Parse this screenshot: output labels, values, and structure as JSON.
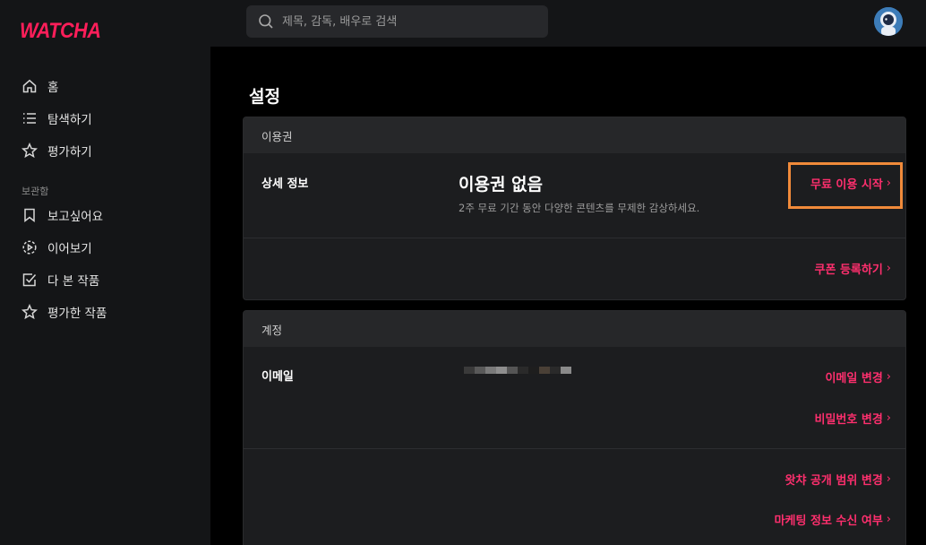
{
  "app": {
    "logo": "WATCHA",
    "brand_color": "#ff1e5a"
  },
  "sidebar": {
    "items": [
      {
        "label": "홈",
        "icon": "home-icon"
      },
      {
        "label": "탐색하기",
        "icon": "list-icon"
      },
      {
        "label": "평가하기",
        "icon": "star-icon"
      }
    ],
    "section_title": "보관함",
    "library": [
      {
        "label": "보고싶어요",
        "icon": "bookmark-icon"
      },
      {
        "label": "이어보기",
        "icon": "play-circle-icon"
      },
      {
        "label": "다 본 작품",
        "icon": "checkbox-icon"
      },
      {
        "label": "평가한 작품",
        "icon": "star-icon"
      }
    ]
  },
  "header": {
    "search_placeholder": "제목, 감독, 배우로 검색",
    "search_icon": "search-icon",
    "avatar_icon": "avatar-icon"
  },
  "page": {
    "title": "설정"
  },
  "subscription": {
    "section_title": "이용권",
    "detail_label": "상세 정보",
    "plan_title": "이용권 없음",
    "plan_desc": "2주 무료 기간 동안 다양한 콘텐츠를 무제한 감상하세요.",
    "free_trial_link": "무료 이용 시작",
    "coupon_link": "쿠폰 등록하기"
  },
  "account": {
    "section_title": "계정",
    "email_label": "이메일",
    "email_change_link": "이메일 변경",
    "password_change_link": "비밀번호 변경",
    "privacy_link": "왓챠 공개 범위 변경",
    "marketing_link": "마케팅 정보 수신 여부"
  },
  "colors": {
    "accent": "#ff2f6e",
    "highlight_box": "#f08a3a"
  }
}
